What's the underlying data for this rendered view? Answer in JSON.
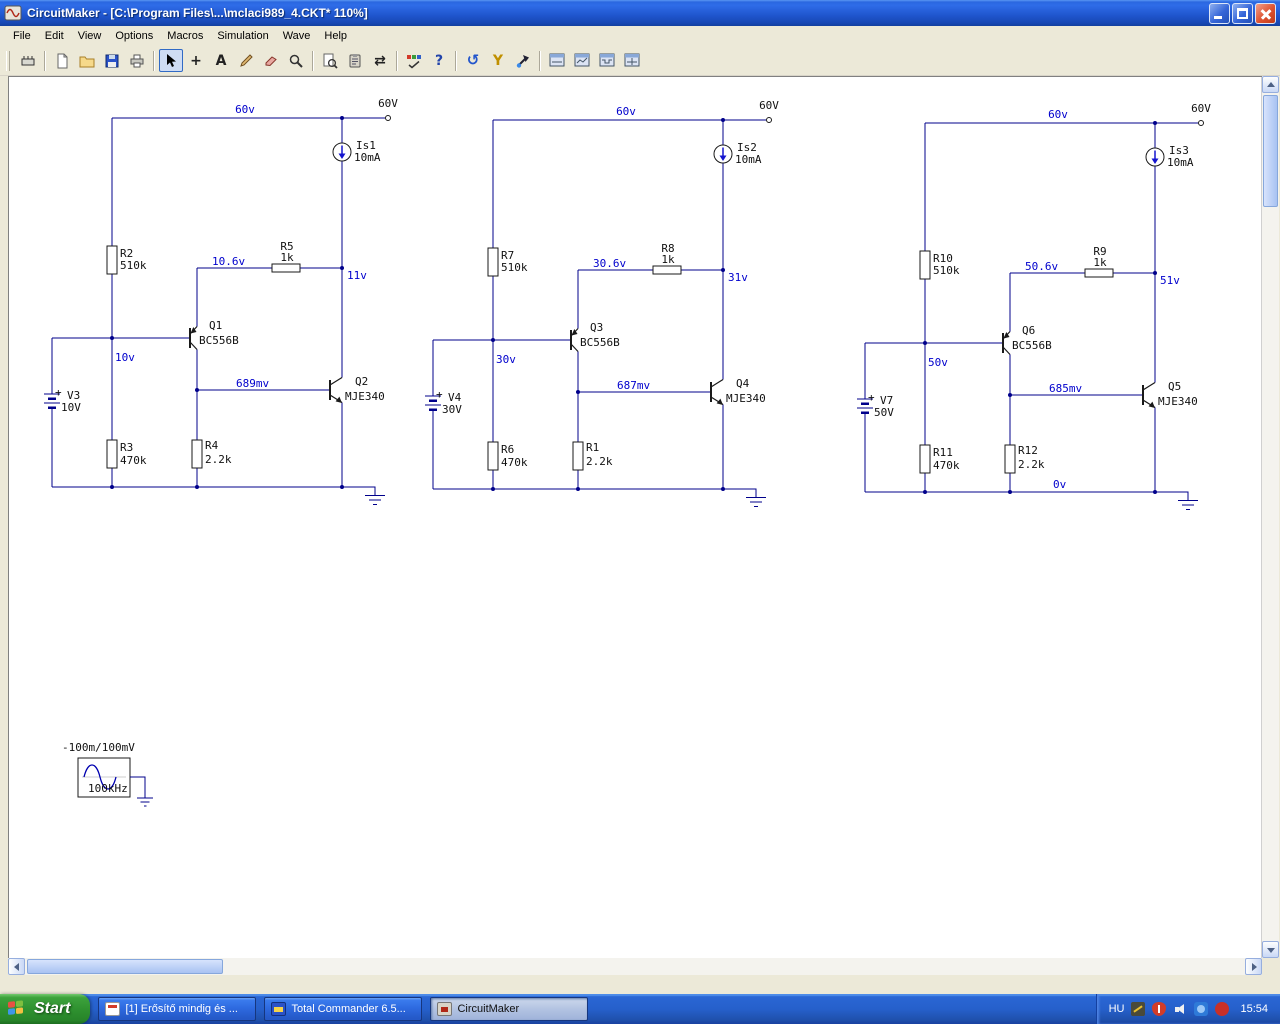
{
  "window": {
    "title": "CircuitMaker - [C:\\Program Files\\...\\mclaci989_4.CKT* 110%]"
  },
  "menu": [
    "File",
    "Edit",
    "View",
    "Options",
    "Macros",
    "Simulation",
    "Wave",
    "Help"
  ],
  "toolbar": {
    "glyphs": {
      "wire_tool": "+",
      "text_tool": "A",
      "help": "?",
      "undo": "↺",
      "probe": "Y",
      "split": "⇄"
    }
  },
  "circuits": [
    {
      "rail_v": "60v",
      "terminal_v": "60V",
      "isrc_name": "Is1",
      "isrc_val": "10mA",
      "r_top": "R2",
      "r_top_val": "510k",
      "r_mid": "R5",
      "r_mid_val": "1k",
      "v_in": "10.6v",
      "v_out": "11v",
      "v_base": "10v",
      "v_fb": "689mv",
      "v_gnd": "",
      "q_top": "Q1",
      "q_top_val": "BC556B",
      "q_bot": "Q2",
      "q_bot_val": "MJE340",
      "bat_plus": "+",
      "bat": "V3",
      "bat_val": "10V",
      "r_left": "R3",
      "r_left_val": "470k",
      "r_right": "R4",
      "r_right_val": "2.2k"
    },
    {
      "rail_v": "60v",
      "terminal_v": "60V",
      "isrc_name": "Is2",
      "isrc_val": "10mA",
      "r_top": "R7",
      "r_top_val": "510k",
      "r_mid": "R8",
      "r_mid_val": "1k",
      "v_in": "30.6v",
      "v_out": "31v",
      "v_base": "30v",
      "v_fb": "687mv",
      "v_gnd": "",
      "q_top": "Q3",
      "q_top_val": "BC556B",
      "q_bot": "Q4",
      "q_bot_val": "MJE340",
      "bat_plus": "+",
      "bat": "V4",
      "bat_val": "30V",
      "r_left": "R6",
      "r_left_val": "470k",
      "r_right": "R1",
      "r_right_val": "2.2k"
    },
    {
      "rail_v": "60v",
      "terminal_v": "60V",
      "isrc_name": "Is3",
      "isrc_val": "10mA",
      "r_top": "R10",
      "r_top_val": "510k",
      "r_mid": "R9",
      "r_mid_val": "1k",
      "v_in": "50.6v",
      "v_out": "51v",
      "v_base": "50v",
      "v_fb": "685mv",
      "v_gnd": "0v",
      "q_top": "Q6",
      "q_top_val": "BC556B",
      "q_bot": "Q5",
      "q_bot_val": "MJE340",
      "bat_plus": "+",
      "bat": "V7",
      "bat_val": "50V",
      "r_left": "R11",
      "r_left_val": "470k",
      "r_right": "R12",
      "r_right_val": "2.2k"
    }
  ],
  "signal_source": {
    "amplitude": "-100m/100mV",
    "frequency": "100kHz"
  },
  "taskbar": {
    "start_label": "Start",
    "tasks": [
      {
        "label": "[1] Erősítő mindig és ...",
        "active": false
      },
      {
        "label": "Total Commander 6.5...",
        "active": false
      },
      {
        "label": "CircuitMaker",
        "active": true
      }
    ],
    "tray_lang": "HU",
    "tray_time": "15:54"
  }
}
